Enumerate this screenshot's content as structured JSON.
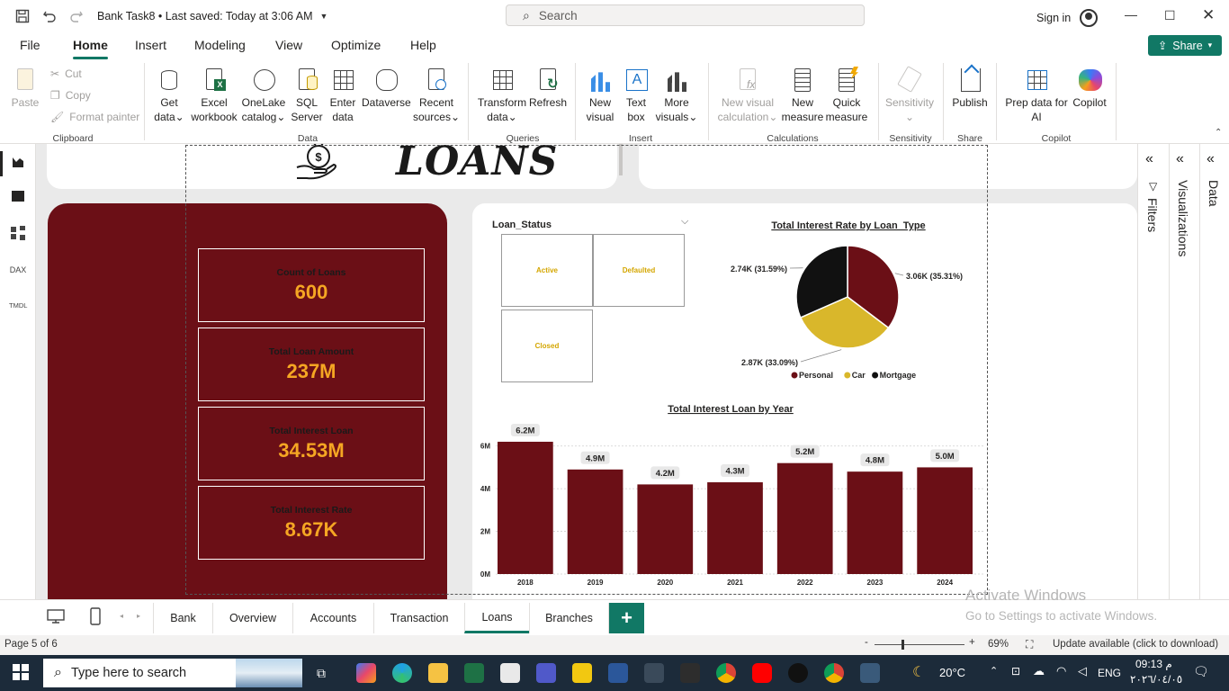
{
  "titlebar": {
    "file_title": "Bank Task8 • Last saved: Today at 3:06 AM",
    "search_placeholder": "Search",
    "sign_in": "Sign in"
  },
  "menu": {
    "tabs": [
      "File",
      "Home",
      "Insert",
      "Modeling",
      "View",
      "Optimize",
      "Help"
    ],
    "active": "Home",
    "share_label": "Share"
  },
  "ribbon": {
    "clipboard": {
      "paste": "Paste",
      "cut": "Cut",
      "copy": "Copy",
      "format_painter": "Format painter",
      "group": "Clipboard"
    },
    "data": {
      "get_data": [
        "Get",
        "data"
      ],
      "excel": [
        "Excel",
        "workbook"
      ],
      "onelake": [
        "OneLake",
        "catalog"
      ],
      "sql": [
        "SQL",
        "Server"
      ],
      "enter": [
        "Enter",
        "data"
      ],
      "dataverse": [
        "Dataverse",
        ""
      ],
      "recent": [
        "Recent",
        "sources"
      ],
      "group": "Data"
    },
    "queries": {
      "transform": [
        "Transform",
        "data"
      ],
      "refresh": [
        "Refresh",
        ""
      ],
      "group": "Queries"
    },
    "insert": {
      "new_visual": [
        "New",
        "visual"
      ],
      "text_box": [
        "Text",
        "box"
      ],
      "more_visuals": [
        "More",
        "visuals"
      ],
      "group": "Insert"
    },
    "calculations": {
      "new_visual_calc": [
        "New visual",
        "calculation"
      ],
      "new_measure": [
        "New",
        "measure"
      ],
      "quick_measure": [
        "Quick",
        "measure"
      ],
      "group": "Calculations"
    },
    "sensitivity": {
      "label": "Sensitivity",
      "group": "Sensitivity"
    },
    "share": {
      "publish": "Publish",
      "group": "Share"
    },
    "copilot": {
      "prep": [
        "Prep data for",
        "AI"
      ],
      "copilot": "Copilot",
      "group": "Copilot"
    }
  },
  "report": {
    "title": "LOANS",
    "kpis": [
      {
        "label": "Count of Loans",
        "value": "600"
      },
      {
        "label": "Total Loan Amount",
        "value": "237M"
      },
      {
        "label": "Total Interest Loan",
        "value": "34.53M"
      },
      {
        "label": "Total Interest Rate",
        "value": "8.67K"
      }
    ],
    "slicer": {
      "title": "Loan_Status",
      "options": [
        "Active",
        "Defaulted",
        "Closed"
      ]
    }
  },
  "colors": {
    "maroon": "#6b0f16",
    "gold": "#d9b72b",
    "black": "#111111",
    "accent": "#117865",
    "kpi_value": "#f5a623"
  },
  "chart_data": [
    {
      "type": "pie",
      "title": "Total Interest Rate by Loan_Type",
      "categories": [
        "Personal",
        "Car",
        "Mortgage"
      ],
      "values": [
        3.06,
        2.87,
        2.74
      ],
      "data_labels": [
        "3.06K (35.31%)",
        "2.87K (33.09%)",
        "2.74K (31.59%)"
      ],
      "legend": "bottom",
      "colors": [
        "#6b0f16",
        "#d9b72b",
        "#111111"
      ]
    },
    {
      "type": "bar",
      "title": "Total Interest Loan by Year",
      "categories": [
        "2018",
        "2019",
        "2020",
        "2021",
        "2022",
        "2023",
        "2024"
      ],
      "values": [
        6.2,
        4.9,
        4.2,
        4.3,
        5.2,
        4.8,
        5.0
      ],
      "data_labels": [
        "6.2M",
        "4.9M",
        "4.2M",
        "4.3M",
        "5.2M",
        "4.8M",
        "5.0M"
      ],
      "y_ticks": [
        "0M",
        "2M",
        "4M",
        "6M"
      ],
      "ylim": [
        0,
        7
      ],
      "grid": true,
      "color": "#6b0f16"
    }
  ],
  "pages": {
    "tabs": [
      "Bank",
      "Overview",
      "Accounts",
      "Transaction",
      "Loans",
      "Branches"
    ],
    "active": "Loans",
    "add_label": "+"
  },
  "statusbar": {
    "page": "Page 5 of 6",
    "zoom": "69%",
    "zoom_minus": "-",
    "zoom_plus": "+",
    "update": "Update available (click to download)"
  },
  "watermark": {
    "line1": "Activate Windows",
    "line2": "Go to Settings to activate Windows."
  },
  "panes": {
    "filters": "Filters",
    "visualizations": "Visualizations",
    "data": "Data"
  },
  "taskbar": {
    "search_placeholder": "Type here to search",
    "temperature": "20°C",
    "language": "ENG",
    "time": "09:13",
    "time_suffix": "م",
    "date": "٢٠٢٦/٠٤/٠٥"
  }
}
